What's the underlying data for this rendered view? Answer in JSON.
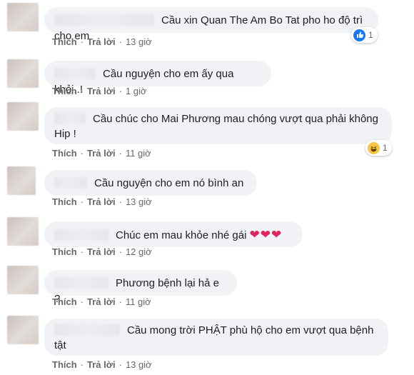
{
  "actions": {
    "like_label": "Thích",
    "reply_label": "Trả lời",
    "separator": "·"
  },
  "comments": [
    {
      "text": "Cầu xin Quan The Am Bo Tat pho ho độ trì cho em",
      "time": "13 giờ",
      "reaction": {
        "type": "like",
        "icon": "like-icon",
        "count": "1"
      }
    },
    {
      "text": "Cầu nguyện cho em ấy qua khỏi..!",
      "time": "1 giờ"
    },
    {
      "text_line1": "Cầu chúc cho Mai Phương mau chóng vượt qua phải không",
      "text_line2": "Hip !",
      "time": "11 giờ",
      "reaction": {
        "type": "haha",
        "icon": "haha-icon",
        "count": "1"
      }
    },
    {
      "text": "Cầu nguyện cho em nó bình an",
      "time": "13 giờ"
    },
    {
      "text": "Chúc em mau khỏe nhé gái",
      "emoji": "❤❤❤",
      "time": "12 giờ"
    },
    {
      "text": "Phương bệnh lại hả e ?",
      "time": "11 giờ"
    },
    {
      "text_line1": "Cầu mong trời PHẬT phù hộ cho em vượt qua bệnh",
      "text_line2": "tật",
      "time": "13 giờ"
    }
  ],
  "colors": {
    "bubble": "#f0f2f5",
    "meta": "#65676b",
    "like": "#1877f2",
    "heart": "#e0245e",
    "haha": "#f7c443"
  }
}
